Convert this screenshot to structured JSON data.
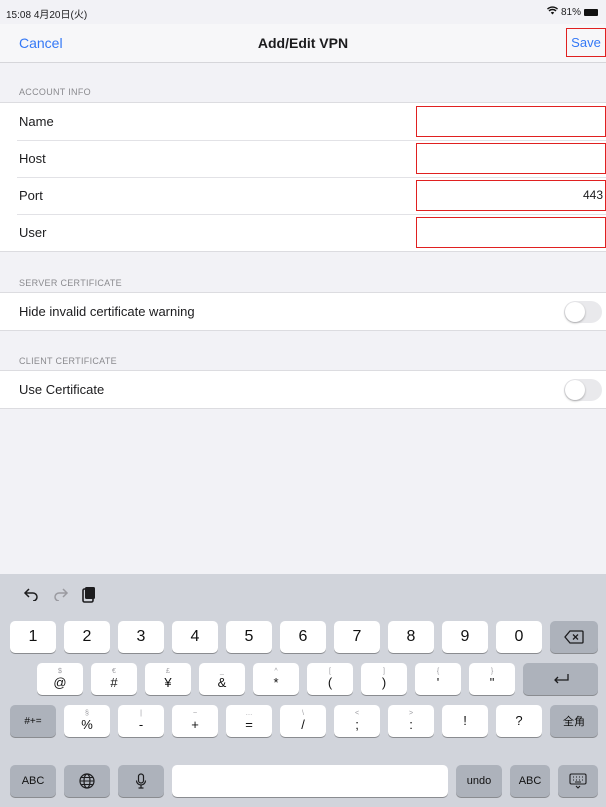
{
  "status": {
    "time": "15:08",
    "date": "4月20日(火)",
    "battery": "81%",
    "icons": [
      "wifi-icon",
      "battery-icon"
    ]
  },
  "nav": {
    "cancel": "Cancel",
    "title": "Add/Edit VPN",
    "save": "Save"
  },
  "colors": {
    "accent": "#3478f6",
    "highlight": "#e02020"
  },
  "account": {
    "header": "ACCOUNT INFO",
    "rows": [
      {
        "label": "Name",
        "value": ""
      },
      {
        "label": "Host",
        "value": ""
      },
      {
        "label": "Port",
        "value": "443"
      },
      {
        "label": "User",
        "value": ""
      }
    ]
  },
  "server": {
    "header": "SERVER CERTIFICATE",
    "label": "Hide invalid certificate warning",
    "enabled": false
  },
  "client": {
    "header": "CLIENT CERTIFICATE",
    "label": "Use Certificate",
    "enabled": false
  },
  "keyboard": {
    "toolbar": [
      "undo-icon",
      "redo-icon",
      "paste-icon"
    ],
    "row1": [
      "1",
      "2",
      "3",
      "4",
      "5",
      "6",
      "7",
      "8",
      "9",
      "0"
    ],
    "row2": [
      {
        "top": "$",
        "main": "@"
      },
      {
        "top": "€",
        "main": "#"
      },
      {
        "top": "£",
        "main": "¥"
      },
      {
        "top": "_",
        "main": "&"
      },
      {
        "top": "^",
        "main": "*"
      },
      {
        "top": "[",
        "main": "("
      },
      {
        "top": "]",
        "main": ")"
      },
      {
        "top": "{",
        "main": "'"
      },
      {
        "top": "}",
        "main": "\""
      }
    ],
    "row3": [
      {
        "top": "§",
        "main": "%"
      },
      {
        "top": "|",
        "main": "-"
      },
      {
        "top": "~",
        "main": "+"
      },
      {
        "top": "…",
        "main": "="
      },
      {
        "top": "\\",
        "main": "/"
      },
      {
        "top": "<",
        "main": ";"
      },
      {
        "top": ">",
        "main": ":"
      },
      {
        "top": "",
        "main": "!"
      },
      {
        "top": "",
        "main": "?"
      }
    ],
    "shift": "#+=",
    "abc": "ABC",
    "undo": "undo",
    "zenkaku": "全角"
  }
}
